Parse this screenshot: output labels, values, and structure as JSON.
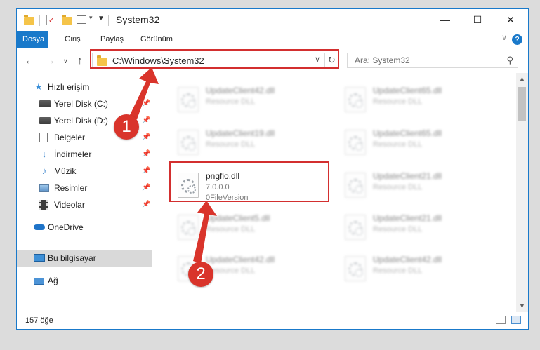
{
  "window": {
    "title": "System32",
    "controls": {
      "minimize": "—",
      "maximize": "☐",
      "close": "✕"
    }
  },
  "ribbon": {
    "tabs": [
      {
        "label": "Dosya",
        "active": true
      },
      {
        "label": "Giriş",
        "active": false
      },
      {
        "label": "Paylaş",
        "active": false
      },
      {
        "label": "Görünüm",
        "active": false
      }
    ],
    "help": "?"
  },
  "nav": {
    "address": "C:\\Windows\\System32",
    "search_placeholder": "Ara: System32"
  },
  "sidebar": {
    "quick_access": "Hızlı erişim",
    "items": [
      {
        "label": "Yerel Disk (C:)",
        "icon": "drive-icon",
        "pinned": true
      },
      {
        "label": "Yerel Disk (D:)",
        "icon": "drive-icon",
        "pinned": true
      },
      {
        "label": "Belgeler",
        "icon": "documents-icon",
        "pinned": true
      },
      {
        "label": "İndirmeler",
        "icon": "downloads-icon",
        "pinned": true
      },
      {
        "label": "Müzik",
        "icon": "music-icon",
        "pinned": true
      },
      {
        "label": "Resimler",
        "icon": "pictures-icon",
        "pinned": true
      },
      {
        "label": "Videolar",
        "icon": "videos-icon",
        "pinned": true
      }
    ],
    "onedrive": "OneDrive",
    "this_pc": "Bu bilgisayar",
    "network": "Ağ"
  },
  "files": {
    "left": [
      {
        "name": "UpdateClient42.dll",
        "type": "Resource DLL"
      },
      {
        "name": "UpdateClient19.dll",
        "type": "Resource DLL"
      },
      {
        "name": "pngfio.dll",
        "version": "7.0.0.0",
        "type": "0FileVersion",
        "highlighted": true
      },
      {
        "name": "UpdateClient5.dll",
        "type": "Resource DLL"
      },
      {
        "name": "UpdateClient42.dll",
        "type": "Resource DLL"
      }
    ],
    "right": [
      {
        "name": "UpdateClient65.dll",
        "type": "Resource DLL"
      },
      {
        "name": "UpdateClient65.dll",
        "type": "Resource DLL"
      },
      {
        "name": "UpdateClient21.dll",
        "type": "Resource DLL"
      },
      {
        "name": "UpdateClient21.dll",
        "type": "Resource DLL"
      },
      {
        "name": "UpdateClient42.dll",
        "type": "Resource DLL"
      }
    ]
  },
  "status": {
    "count": "157 öğe"
  },
  "annotations": {
    "step1": "1",
    "step2": "2"
  },
  "colors": {
    "accent": "#1979ca",
    "highlight": "#d32f2f",
    "badge": "#d9342b"
  }
}
